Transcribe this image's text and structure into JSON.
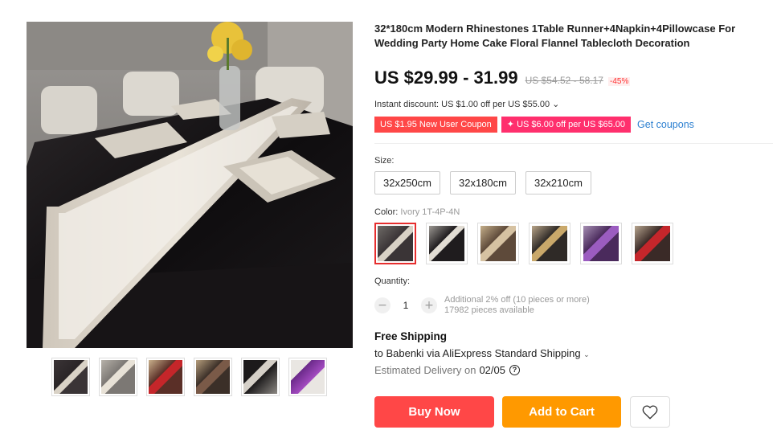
{
  "product": {
    "title": "32*180cm Modern Rhinestones 1Table Runner+4Napkin+4Pillowcase For Wedding Party Home Cake Floral Flannel Tablecloth Decoration",
    "price_range": "US $29.99 - 31.99",
    "original_price": "US $54.52 - 58.17",
    "discount_badge": "-45%"
  },
  "instant_discount": "Instant discount: US $1.00 off per US $55.00 ⌄",
  "coupons": {
    "new_user": "US $1.95 New User Coupon",
    "store": "✦ US $6.00 off per US $65.00",
    "get_link": "Get coupons"
  },
  "size": {
    "label": "Size:",
    "options": [
      "32x250cm",
      "32x180cm",
      "32x210cm"
    ]
  },
  "color": {
    "label": "Color:",
    "selected_value": "Ivory 1T-4P-4N",
    "option_count": 6
  },
  "quantity": {
    "label": "Quantity:",
    "value": "1",
    "minus": "−",
    "plus": "+",
    "additional": "Additional 2% off (10 pieces or more)",
    "available": "17982 pieces available"
  },
  "shipping": {
    "title": "Free Shipping",
    "to_text": "to Babenki via AliExpress Standard Shipping",
    "chevron": "⌄",
    "estimated_label": "Estimated Delivery on",
    "estimated_date": "02/05",
    "help_icon": "?"
  },
  "actions": {
    "buy_now": "Buy Now",
    "add_to_cart": "Add to Cart",
    "wishlist_icon": "heart-icon"
  },
  "theme": {
    "price_red": "#ff4747",
    "coupon_pink": "#ff2f6d",
    "cart_orange": "#ff9900",
    "link_blue": "#2b7fd0"
  }
}
